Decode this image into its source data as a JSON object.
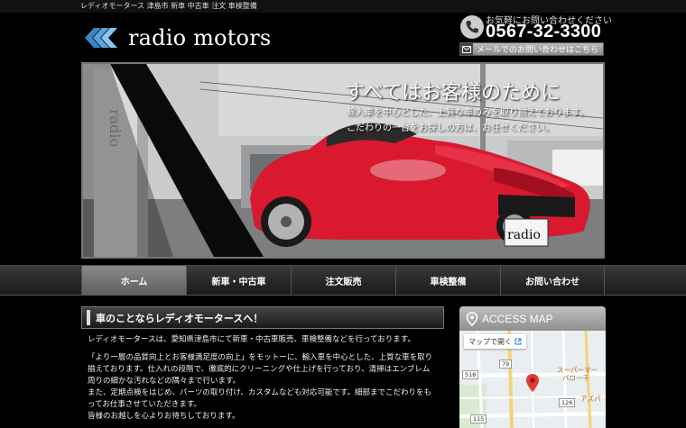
{
  "topbar": {
    "text": "レディオモータース 津島市 新車 中古車 注文 車検整備"
  },
  "header": {
    "logo_name": "radio motors",
    "contact_note": "お気軽にお問い合わせください",
    "phone": "0567-32-3300",
    "mail_label": "メールでのお問い合わせはこちら"
  },
  "hero": {
    "title": "すべてはお客様のために",
    "lines": [
      "輸入車を中心とした、上質な車のみを取り揃えております。",
      "こだわりの一台をお探しの方は、お任せください。"
    ],
    "plate_text": "radio",
    "pillar_text": "radio"
  },
  "nav": {
    "items": [
      {
        "label": "ホーム",
        "active": true
      },
      {
        "label": "新車・中古車",
        "active": false
      },
      {
        "label": "注文販売",
        "active": false
      },
      {
        "label": "車検整備",
        "active": false
      },
      {
        "label": "お問い合わせ",
        "active": false
      }
    ]
  },
  "main": {
    "heading": "車のことならレディオモータースへ！",
    "paragraphs": [
      "レディオモータースは、愛知県津島市にて新車・中古車販売、車検整備などを行っております。",
      "「より一層の品質向上とお客様満足度の向上」をモットーに、輸入車を中心とした、上質な車を取り揃えております。仕入れの段階で、徹底的にクリーニングや仕上げを行っており、清掃はエンブレム周りの細かな汚れなどの隅々まで行います。",
      "また、定期点検をはじめ、パーツの取り付け、カスタムなども対応可能です。細部までこだわりをもってお仕事させていただきます。",
      "皆様のお越しを心よりお待ちしております。"
    ]
  },
  "map": {
    "title": "ACCESS MAP",
    "open_label": "マップで開く",
    "poi_1": "スーパーマー",
    "poi_2": "バロー千",
    "poi_3": "アズパ",
    "roads": [
      "79",
      "518",
      "126",
      "115"
    ]
  },
  "colors": {
    "background": "#000000",
    "car_red": "#d8192e",
    "nav_active": "#7a7a7a",
    "map_pin": "#e53935"
  }
}
